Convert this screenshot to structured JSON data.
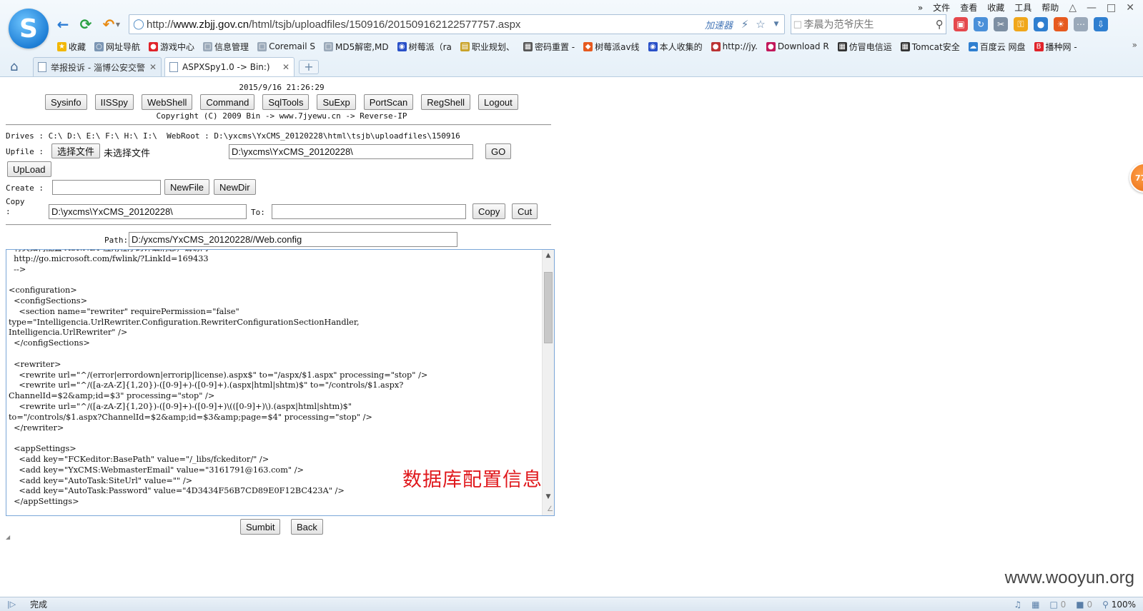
{
  "browser": {
    "menu": [
      "文件",
      "查看",
      "收藏",
      "工具",
      "帮助"
    ],
    "url_prefix": "http://",
    "url_host": "www.zbjj.gov.cn",
    "url_path": "/html/tsjb/uploadfiles/150916/201509162122577757.aspx",
    "accelerator_label": "加速器",
    "search_placeholder": "李晨为范爷庆生",
    "bookmarks": [
      "收藏",
      "网址导航",
      "游戏中心",
      "信息管理",
      "Coremail S",
      "MD5解密,MD",
      "树莓派（ra",
      "职业规划、",
      "密码重置 -",
      "树莓派av线",
      "本人收集的",
      "http://jy.",
      "Download R",
      "仿冒电信运",
      "Tomcat安全",
      "百度云 网盘",
      "播种网 -"
    ],
    "bookmark_more": "»",
    "tabs": [
      {
        "title": "举报投诉 - 淄博公安交警"
      },
      {
        "title": "ASPXSpy1.0 -> Bin:)"
      }
    ],
    "new_tab": "+",
    "status_text": "完成",
    "status_count_1": "0",
    "status_count_2": "0",
    "zoom": "100%",
    "float_badge": "77"
  },
  "page": {
    "datetime": "2015/9/16 21:26:29",
    "toolbar": [
      "Sysinfo",
      "IISSpy",
      "WebShell",
      "Command",
      "SqlTools",
      "SuExp",
      "PortScan",
      "RegShell",
      "Logout"
    ],
    "copyright": "Copyright (C) 2009 Bin -> www.7jyewu.cn -> Reverse-IP",
    "drives_line": "Drives : C:\\ D:\\ E:\\ F:\\ H:\\ I:\\  WebRoot : D:\\yxcms\\YxCMS_20120228\\html\\tsjb\\uploadfiles\\150916",
    "upfile_label": "Upfile :",
    "choose_file_label": "选择文件",
    "no_file_label": "未选择文件",
    "upfile_path": "D:\\yxcms\\YxCMS_20120228\\",
    "go_label": "GO",
    "upload_label": "UpLoad",
    "create_label": "Create :",
    "create_value": "",
    "newfile_label": "NewFile",
    "newdir_label": "NewDir",
    "copy_label": "Copy\n:",
    "copy_value": "D:\\yxcms\\YxCMS_20120228\\",
    "to_label": "To:",
    "to_value": "",
    "copy_btn_label": "Copy",
    "cut_btn_label": "Cut",
    "path_label": "Path:",
    "path_value": "D:/yxcms/YxCMS_20120228//Web.config",
    "editor_text": "  有关如何配置 ASP.NET 应用程序的详细消息，请访问\n  http://go.microsoft.com/fwlink/?LinkId=169433\n  -->\n\n<configuration>\n  <configSections>\n    <section name=\"rewriter\" requirePermission=\"false\"\ntype=\"Intelligencia.UrlRewriter.Configuration.RewriterConfigurationSectionHandler,\nIntelligencia.UrlRewriter\" />\n  </configSections>\n\n  <rewriter>\n    <rewrite url=\"^/(error|errordown|errorip|license).aspx$\" to=\"/aspx/$1.aspx\" processing=\"stop\" />\n    <rewrite url=\"^/([a-zA-Z]{1,20})-([0-9]+)-([0-9]+).(aspx|html|shtm)$\" to=\"/controls/$1.aspx?\nChannelId=$2&amp;id=$3\" processing=\"stop\" />\n    <rewrite url=\"^/([a-zA-Z]{1,20})-([0-9]+)-([0-9]+)\\(([0-9]+)\\).(aspx|html|shtm)$\"\nto=\"/controls/$1.aspx?ChannelId=$2&amp;id=$3&amp;page=$4\" processing=\"stop\" />\n  </rewriter>\n\n  <appSettings>\n    <add key=\"FCKeditor:BasePath\" value=\"/_libs/fckeditor/\" />\n    <add key=\"YxCMS:WebmasterEmail\" value=\"3161791@163.com\" />\n    <add key=\"AutoTask:SiteUrl\" value=\"\" />\n    <add key=\"AutoTask:Password\" value=\"4D3434F56B7CD89E0F12BC423A\" />\n  </appSettings>",
    "annotation": "数据库配置信息",
    "submit_label": "Sumbit",
    "back_label": "Back",
    "watermark": "www.wooyun.org"
  },
  "colors": {
    "annotation": "#e0191d",
    "editor_border": "#7aa6d8",
    "chrome_bg": "#e6f0f8"
  }
}
